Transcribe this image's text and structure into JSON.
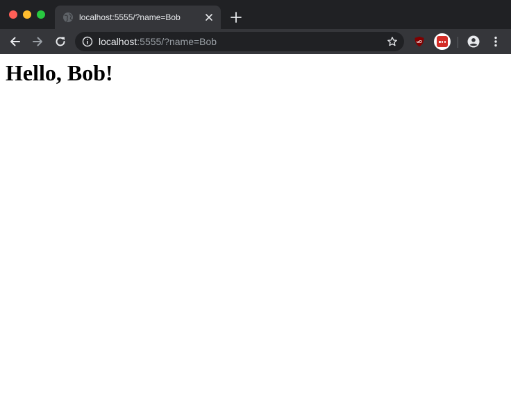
{
  "browser": {
    "tab": {
      "title": "localhost:5555/?name=Bob"
    },
    "omnibox": {
      "url_host": "localhost",
      "url_rest": ":5555/?name=Bob"
    },
    "icons": {
      "traffic_close": "window-close-dot",
      "traffic_minimize": "window-minimize-dot",
      "traffic_maximize": "window-maximize-dot",
      "tab_favicon": "globe-icon",
      "tab_close": "close-icon",
      "new_tab": "plus-icon",
      "back": "arrow-left-icon",
      "forward": "arrow-right-icon",
      "reload": "reload-icon",
      "site_info": "info-icon",
      "bookmark": "star-icon",
      "ublock": "ublock-origin-icon",
      "lastpass": "lastpass-icon",
      "profile": "account-circle-icon",
      "menu": "kebab-menu-icon"
    },
    "colors": {
      "frame": "#202124",
      "toolbar": "#35363a",
      "text": "#e8eaed",
      "muted_text": "#9aa0a6"
    }
  },
  "page": {
    "heading": "Hello, Bob!"
  }
}
